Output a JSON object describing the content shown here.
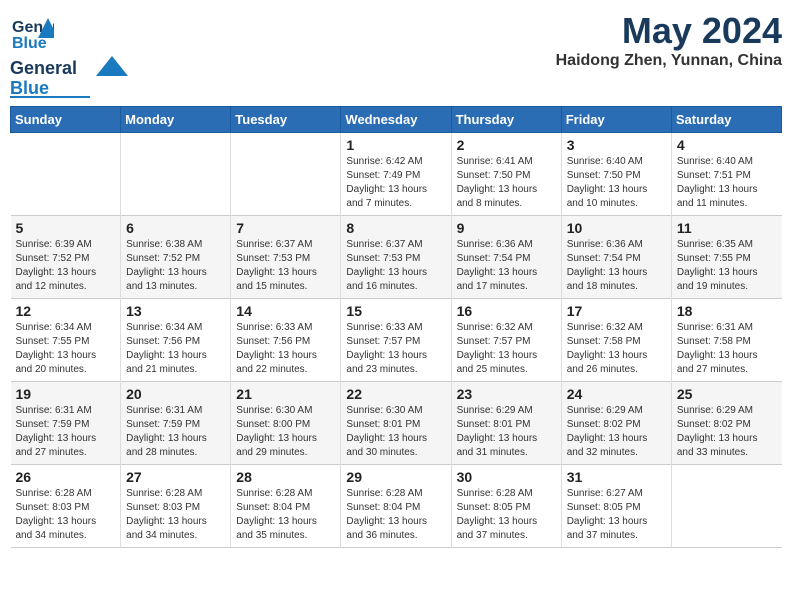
{
  "header": {
    "logo_general": "General",
    "logo_blue": "Blue",
    "month_year": "May 2024",
    "location": "Haidong Zhen, Yunnan, China"
  },
  "days_of_week": [
    "Sunday",
    "Monday",
    "Tuesday",
    "Wednesday",
    "Thursday",
    "Friday",
    "Saturday"
  ],
  "weeks": [
    [
      {
        "day": "",
        "info": ""
      },
      {
        "day": "",
        "info": ""
      },
      {
        "day": "",
        "info": ""
      },
      {
        "day": "1",
        "info": "Sunrise: 6:42 AM\nSunset: 7:49 PM\nDaylight: 13 hours\nand 7 minutes."
      },
      {
        "day": "2",
        "info": "Sunrise: 6:41 AM\nSunset: 7:50 PM\nDaylight: 13 hours\nand 8 minutes."
      },
      {
        "day": "3",
        "info": "Sunrise: 6:40 AM\nSunset: 7:50 PM\nDaylight: 13 hours\nand 10 minutes."
      },
      {
        "day": "4",
        "info": "Sunrise: 6:40 AM\nSunset: 7:51 PM\nDaylight: 13 hours\nand 11 minutes."
      }
    ],
    [
      {
        "day": "5",
        "info": "Sunrise: 6:39 AM\nSunset: 7:52 PM\nDaylight: 13 hours\nand 12 minutes."
      },
      {
        "day": "6",
        "info": "Sunrise: 6:38 AM\nSunset: 7:52 PM\nDaylight: 13 hours\nand 13 minutes."
      },
      {
        "day": "7",
        "info": "Sunrise: 6:37 AM\nSunset: 7:53 PM\nDaylight: 13 hours\nand 15 minutes."
      },
      {
        "day": "8",
        "info": "Sunrise: 6:37 AM\nSunset: 7:53 PM\nDaylight: 13 hours\nand 16 minutes."
      },
      {
        "day": "9",
        "info": "Sunrise: 6:36 AM\nSunset: 7:54 PM\nDaylight: 13 hours\nand 17 minutes."
      },
      {
        "day": "10",
        "info": "Sunrise: 6:36 AM\nSunset: 7:54 PM\nDaylight: 13 hours\nand 18 minutes."
      },
      {
        "day": "11",
        "info": "Sunrise: 6:35 AM\nSunset: 7:55 PM\nDaylight: 13 hours\nand 19 minutes."
      }
    ],
    [
      {
        "day": "12",
        "info": "Sunrise: 6:34 AM\nSunset: 7:55 PM\nDaylight: 13 hours\nand 20 minutes."
      },
      {
        "day": "13",
        "info": "Sunrise: 6:34 AM\nSunset: 7:56 PM\nDaylight: 13 hours\nand 21 minutes."
      },
      {
        "day": "14",
        "info": "Sunrise: 6:33 AM\nSunset: 7:56 PM\nDaylight: 13 hours\nand 22 minutes."
      },
      {
        "day": "15",
        "info": "Sunrise: 6:33 AM\nSunset: 7:57 PM\nDaylight: 13 hours\nand 23 minutes."
      },
      {
        "day": "16",
        "info": "Sunrise: 6:32 AM\nSunset: 7:57 PM\nDaylight: 13 hours\nand 25 minutes."
      },
      {
        "day": "17",
        "info": "Sunrise: 6:32 AM\nSunset: 7:58 PM\nDaylight: 13 hours\nand 26 minutes."
      },
      {
        "day": "18",
        "info": "Sunrise: 6:31 AM\nSunset: 7:58 PM\nDaylight: 13 hours\nand 27 minutes."
      }
    ],
    [
      {
        "day": "19",
        "info": "Sunrise: 6:31 AM\nSunset: 7:59 PM\nDaylight: 13 hours\nand 27 minutes."
      },
      {
        "day": "20",
        "info": "Sunrise: 6:31 AM\nSunset: 7:59 PM\nDaylight: 13 hours\nand 28 minutes."
      },
      {
        "day": "21",
        "info": "Sunrise: 6:30 AM\nSunset: 8:00 PM\nDaylight: 13 hours\nand 29 minutes."
      },
      {
        "day": "22",
        "info": "Sunrise: 6:30 AM\nSunset: 8:01 PM\nDaylight: 13 hours\nand 30 minutes."
      },
      {
        "day": "23",
        "info": "Sunrise: 6:29 AM\nSunset: 8:01 PM\nDaylight: 13 hours\nand 31 minutes."
      },
      {
        "day": "24",
        "info": "Sunrise: 6:29 AM\nSunset: 8:02 PM\nDaylight: 13 hours\nand 32 minutes."
      },
      {
        "day": "25",
        "info": "Sunrise: 6:29 AM\nSunset: 8:02 PM\nDaylight: 13 hours\nand 33 minutes."
      }
    ],
    [
      {
        "day": "26",
        "info": "Sunrise: 6:28 AM\nSunset: 8:03 PM\nDaylight: 13 hours\nand 34 minutes."
      },
      {
        "day": "27",
        "info": "Sunrise: 6:28 AM\nSunset: 8:03 PM\nDaylight: 13 hours\nand 34 minutes."
      },
      {
        "day": "28",
        "info": "Sunrise: 6:28 AM\nSunset: 8:04 PM\nDaylight: 13 hours\nand 35 minutes."
      },
      {
        "day": "29",
        "info": "Sunrise: 6:28 AM\nSunset: 8:04 PM\nDaylight: 13 hours\nand 36 minutes."
      },
      {
        "day": "30",
        "info": "Sunrise: 6:28 AM\nSunset: 8:05 PM\nDaylight: 13 hours\nand 37 minutes."
      },
      {
        "day": "31",
        "info": "Sunrise: 6:27 AM\nSunset: 8:05 PM\nDaylight: 13 hours\nand 37 minutes."
      },
      {
        "day": "",
        "info": ""
      }
    ]
  ]
}
